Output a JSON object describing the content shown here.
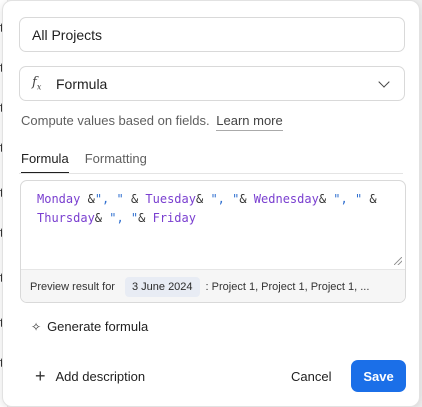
{
  "field": {
    "name_value": "All Projects"
  },
  "field_type": {
    "selected": "Formula",
    "icon": "fx-icon"
  },
  "help": {
    "text": "Compute values based on fields.",
    "link": "Learn more"
  },
  "tabs": [
    {
      "label": "Formula",
      "active": true
    },
    {
      "label": "Formatting",
      "active": false
    }
  ],
  "formula": {
    "tokens": [
      {
        "t": "fld",
        "v": "Monday"
      },
      {
        "t": "op",
        "v": " &"
      },
      {
        "t": "str",
        "v": "\", \""
      },
      {
        "t": "op",
        "v": " & "
      },
      {
        "t": "fld",
        "v": "Tuesday"
      },
      {
        "t": "op",
        "v": "& "
      },
      {
        "t": "str",
        "v": "\", \""
      },
      {
        "t": "op",
        "v": "& "
      },
      {
        "t": "fld",
        "v": "Wednesday"
      },
      {
        "t": "op",
        "v": "& "
      },
      {
        "t": "str",
        "v": "\", \""
      },
      {
        "t": "op",
        "v": " &\n"
      },
      {
        "t": "fld",
        "v": "Thursday"
      },
      {
        "t": "op",
        "v": "& "
      },
      {
        "t": "str",
        "v": "\", \""
      },
      {
        "t": "op",
        "v": "& "
      },
      {
        "t": "fld",
        "v": "Friday"
      }
    ]
  },
  "preview": {
    "label": "Preview result for",
    "date": "3 June 2024",
    "result": ": Project 1, Project 1, Project 1, ..."
  },
  "actions": {
    "generate": "Generate formula",
    "add_description": "Add description",
    "cancel": "Cancel",
    "save": "Save"
  },
  "colors": {
    "accent": "#1b6fe8",
    "field_token": "#7a3fd0",
    "string_token": "#2f6fcf"
  },
  "background_edge_glyphs": [
    "t",
    "t",
    "t",
    "t",
    "t",
    "t",
    "t",
    "t",
    "t"
  ]
}
